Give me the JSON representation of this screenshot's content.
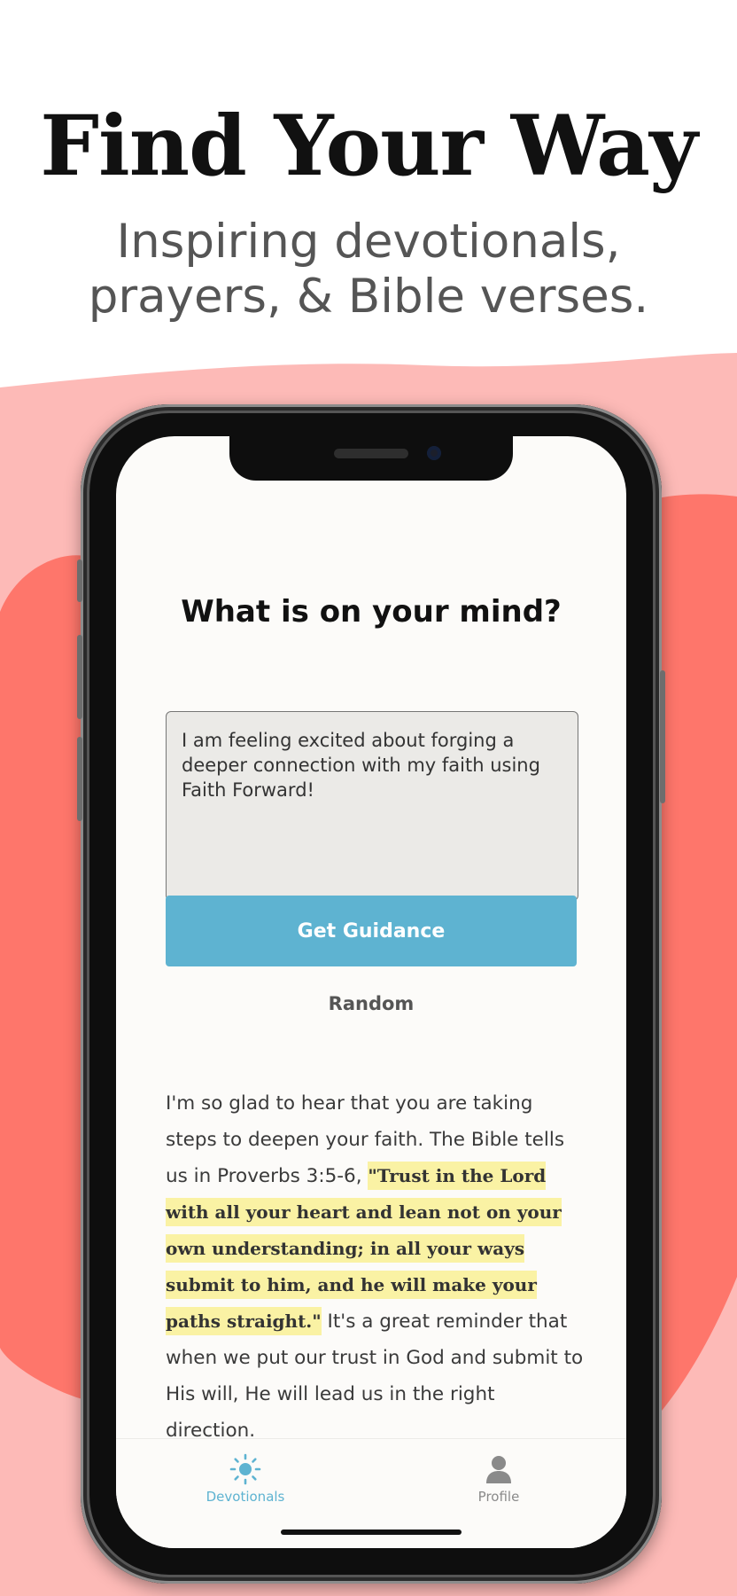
{
  "marketing": {
    "headline": "Find Your Way",
    "subheadline_line1": "Inspiring devotionals,",
    "subheadline_line2": "prayers, & Bible verses."
  },
  "colors": {
    "background_pink": "#fdbab7",
    "blob_coral": "#fe766b",
    "accent_blue": "#5eb3d1",
    "highlight_yellow": "#faf2a4",
    "screen_bg": "#fcfbf9"
  },
  "screen": {
    "question": "What is on your mind?",
    "input": {
      "value": "I am feeling excited about forging a deeper connection with my faith using Faith Forward!"
    },
    "primary_button": "Get Guidance",
    "secondary_button": "Random",
    "response": {
      "intro": "I'm so glad to hear that you are taking steps to deepen your faith. The Bible tells us in Proverbs 3:5-6, ",
      "verse": "\"Trust in the Lord with all your heart and lean not on your own understanding; in all your ways submit to him, and he will make your paths straight.\"",
      "outro": " It's a great reminder that when we put our trust in God and submit to His will, He will lead us in the right direction."
    }
  },
  "tabbar": {
    "tabs": [
      {
        "label": "Devotionals",
        "icon": "sun-icon",
        "active": true
      },
      {
        "label": "Profile",
        "icon": "person-icon",
        "active": false
      }
    ]
  }
}
